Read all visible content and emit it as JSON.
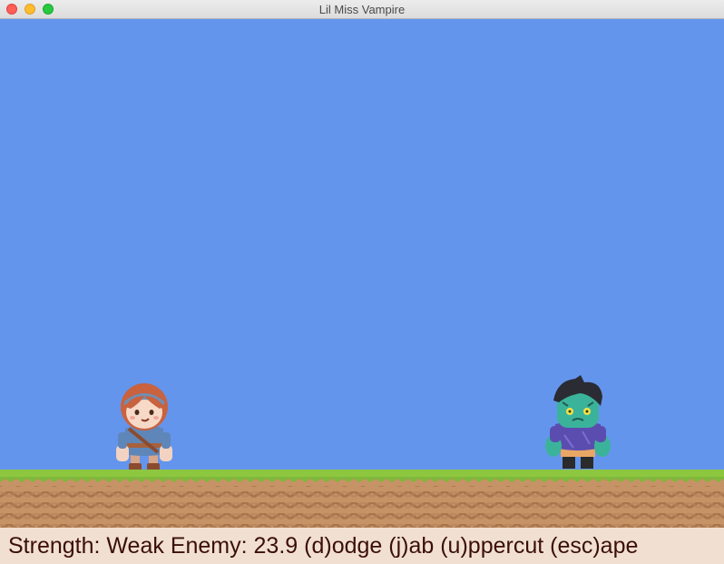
{
  "window": {
    "title": "Lil Miss Vampire"
  },
  "game": {
    "hero": {
      "name": "player-character"
    },
    "enemy": {
      "name": "zombie-enemy"
    }
  },
  "hud": {
    "strength_label": "Strength:",
    "strength_value": "Weak",
    "enemy_label": "Enemy:",
    "enemy_value": "23.9",
    "controls": "(d)odge (j)ab (u)ppercut (esc)ape"
  },
  "colors": {
    "sky": "#6495ed",
    "grass": "#8dc63f",
    "dirt": "#c69366",
    "hud_bg": "#f1e0d2",
    "hud_text": "#3b0e0a"
  }
}
